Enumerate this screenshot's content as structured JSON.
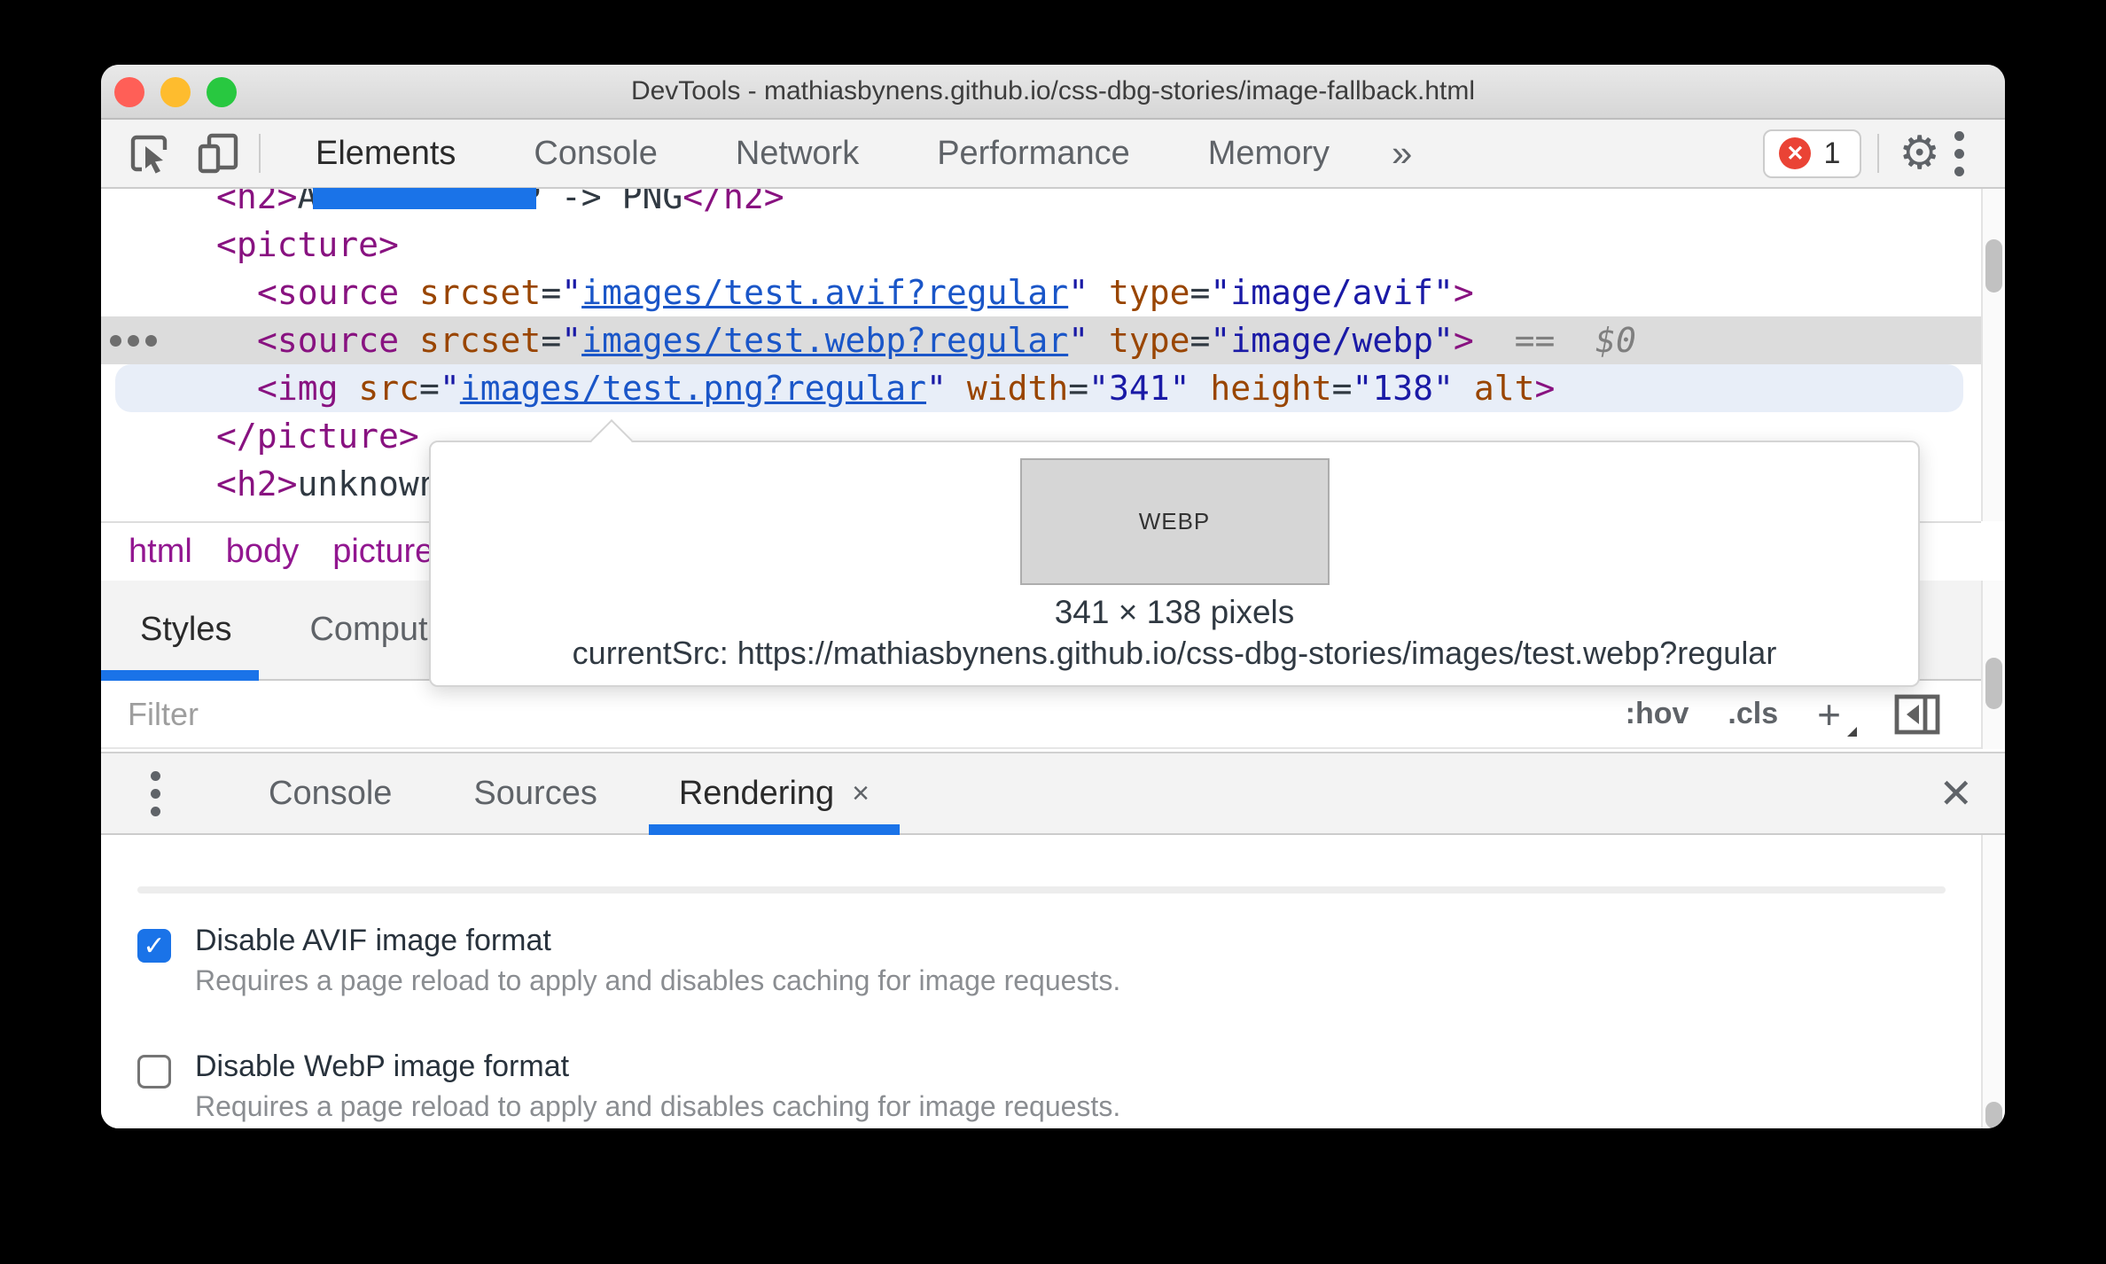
{
  "window": {
    "title": "DevTools - mathiasbynens.github.io/css-dbg-stories/image-fallback.html"
  },
  "toolbar": {
    "tabs": [
      "Elements",
      "Console",
      "Network",
      "Performance",
      "Memory"
    ],
    "active_tab": "Elements",
    "more_tabs_glyph": "»",
    "error_count": "1",
    "error_icon_glyph": "✕",
    "gear_icon_glyph": "⚙"
  },
  "elements_panel": {
    "code_lines": [
      {
        "indent": 130,
        "segments": [
          [
            "tag",
            "<h2>"
          ],
          [
            "text",
            "AVIF -> WebP -> PNG"
          ],
          [
            "tag",
            "</h2>"
          ]
        ]
      },
      {
        "indent": 130,
        "segments": [
          [
            "tag",
            "<picture>"
          ]
        ]
      },
      {
        "indent": 176,
        "segments": [
          [
            "tag",
            "<source"
          ],
          [
            "text",
            " "
          ],
          [
            "attr",
            "srcset"
          ],
          [
            "text",
            "="
          ],
          [
            "val",
            "\""
          ],
          [
            "link",
            "images/test.avif?regular"
          ],
          [
            "val",
            "\""
          ],
          [
            "text",
            " "
          ],
          [
            "attr",
            "type"
          ],
          [
            "text",
            "="
          ],
          [
            "val",
            "\"image/avif\""
          ],
          [
            "tag",
            ">"
          ]
        ]
      },
      {
        "indent": 176,
        "highlight": "selected",
        "gutter_dots": true,
        "segments": [
          [
            "tag",
            "<source"
          ],
          [
            "text",
            " "
          ],
          [
            "attr",
            "srcset"
          ],
          [
            "text",
            "="
          ],
          [
            "val",
            "\""
          ],
          [
            "link",
            "images/test.webp?regular"
          ],
          [
            "val",
            "\""
          ],
          [
            "text",
            " "
          ],
          [
            "attr",
            "type"
          ],
          [
            "text",
            "="
          ],
          [
            "val",
            "\"image/webp\""
          ],
          [
            "tag",
            ">"
          ],
          [
            "meta",
            "  ==  "
          ],
          [
            "meta_italic",
            "$0"
          ]
        ]
      },
      {
        "indent": 176,
        "highlight": "hover",
        "segments": [
          [
            "tag",
            "<img"
          ],
          [
            "text",
            " "
          ],
          [
            "attr",
            "src"
          ],
          [
            "text",
            "="
          ],
          [
            "val",
            "\""
          ],
          [
            "link",
            "images/test.png?regular"
          ],
          [
            "val",
            "\""
          ],
          [
            "text",
            " "
          ],
          [
            "attr",
            "width"
          ],
          [
            "text",
            "="
          ],
          [
            "val",
            "\"341\""
          ],
          [
            "text",
            " "
          ],
          [
            "attr",
            "height"
          ],
          [
            "text",
            "="
          ],
          [
            "val",
            "\"138\""
          ],
          [
            "text",
            " "
          ],
          [
            "attr",
            "alt"
          ],
          [
            "tag",
            ">"
          ]
        ]
      },
      {
        "indent": 130,
        "segments": [
          [
            "tag",
            "</picture>"
          ]
        ]
      },
      {
        "indent": 130,
        "segments": [
          [
            "tag",
            "<h2>"
          ],
          [
            "text",
            "unknown"
          ]
        ]
      }
    ],
    "breadcrumbs": [
      "html",
      "body",
      "picture"
    ]
  },
  "styles_panel": {
    "tabs": [
      "Styles",
      "Computed"
    ],
    "active_tab": "Styles",
    "filter_placeholder": "Filter",
    "controls": [
      ":hov",
      ".cls",
      "+"
    ]
  },
  "tooltip": {
    "image_label": "WEBP",
    "dimensions": "341 × 138 pixels",
    "current_src": "currentSrc: https://mathiasbynens.github.io/css-dbg-stories/images/test.webp?regular"
  },
  "drawer": {
    "tabs": [
      "Console",
      "Sources",
      "Rendering"
    ],
    "active_tab": "Rendering",
    "tab_close_glyph": "×",
    "close_glyph": "✕"
  },
  "rendering": {
    "items": [
      {
        "label": "Disable AVIF image format",
        "description": "Requires a page reload to apply and disables caching for image requests.",
        "checked": true,
        "check_glyph": "✓"
      },
      {
        "label": "Disable WebP image format",
        "description": "Requires a page reload to apply and disables caching for image requests.",
        "checked": false,
        "check_glyph": ""
      }
    ]
  },
  "colors": {
    "accent_blue": "#1a73e8",
    "error_red": "#ea4335",
    "selected_row": "#dcdcdc",
    "hover_row": "#e8eef8",
    "code_tag": "#881280",
    "code_attr": "#994500",
    "code_value": "#1a1aa6",
    "code_link": "#1a56c8",
    "traffic_lights": [
      "#ff5f57",
      "#febc2e",
      "#28c840"
    ]
  }
}
